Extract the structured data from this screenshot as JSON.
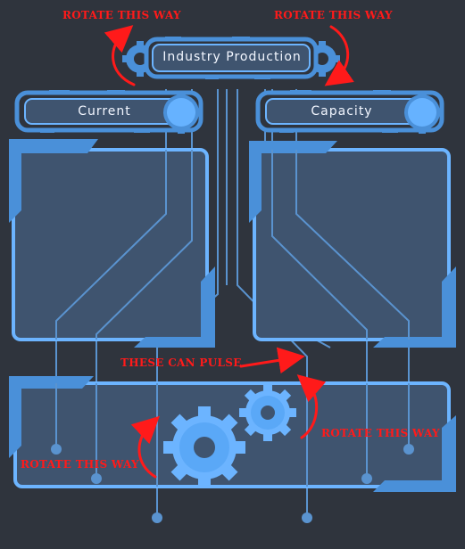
{
  "title": "Industry Production",
  "current_label": "Current",
  "capacity_label": "Capacity",
  "notes": {
    "rotate_left_top": "ROTATE THIS WAY",
    "rotate_right_top": "ROTATE THIS WAY",
    "pulse": "THESE CAN PULSE",
    "rotate_small_gear": "ROTATE THIS WAY",
    "rotate_big_gear": "ROTATE THIS WAY"
  },
  "colors": {
    "background": "#2f343d",
    "panel_fill": "#3f546f",
    "accent": "#4a90d9",
    "accent_light": "#6cb4ff",
    "line": "#5a93cf",
    "annotation": "#ff1a1a"
  }
}
